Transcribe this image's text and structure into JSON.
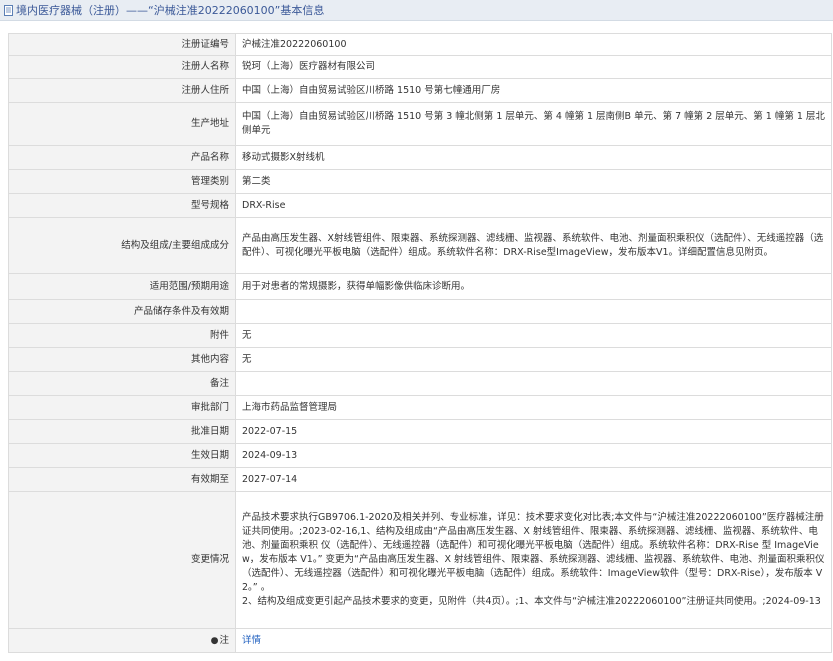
{
  "header": {
    "title": "境内医疗器械（注册）——“沪械注准20222060100”基本信息"
  },
  "rows": [
    {
      "label": "注册证编号",
      "value": "沪械注准20222060100"
    },
    {
      "label": "注册人名称",
      "value": "锐珂（上海）医疗器材有限公司"
    },
    {
      "label": "注册人住所",
      "value": "中国（上海）自由贸易试验区川桥路 1510 号第七幢通用厂房"
    },
    {
      "label": "生产地址",
      "value": "中国（上海）自由贸易试验区川桥路 1510 号第 3 幢北侧第 1 层单元、第 4 幢第 1 层南侧B 单元、第 7 幢第 2 层单元、第 1 幢第 1 层北侧单元"
    },
    {
      "label": "产品名称",
      "value": "移动式摄影X射线机"
    },
    {
      "label": "管理类别",
      "value": "第二类"
    },
    {
      "label": "型号规格",
      "value": "DRX-Rise"
    },
    {
      "label": "结构及组成/主要组成成分",
      "value": "产品由高压发生器、X射线管组件、限束器、系统探测器、滤线栅、监视器、系统软件、电池、剂量面积乘积仪（选配件）、无线遥控器（选配件）、可视化曝光平板电脑（选配件）组成。系统软件名称：DRX-Rise型ImageView，发布版本V1。详细配置信息见附页。"
    },
    {
      "label": "适用范围/预期用途",
      "value": "用于对患者的常规摄影，获得单幅影像供临床诊断用。"
    },
    {
      "label": "产品储存条件及有效期",
      "value": ""
    },
    {
      "label": "附件",
      "value": "无"
    },
    {
      "label": "其他内容",
      "value": "无"
    },
    {
      "label": "备注",
      "value": ""
    },
    {
      "label": "审批部门",
      "value": "上海市药品监督管理局"
    },
    {
      "label": "批准日期",
      "value": "2022-07-15"
    },
    {
      "label": "生效日期",
      "value": "2024-09-13"
    },
    {
      "label": "有效期至",
      "value": "2027-07-14"
    },
    {
      "label": "变更情况",
      "value": "产品技术要求执行GB9706.1-2020及相关并列、专业标准，详见：技术要求变化对比表;本文件与“沪械注准20222060100”医疗器械注册证共同使用。;2023-02-16,1、结构及组成由“产品由高压发生器、X 射线管组件、限束器、系统探测器、滤线栅、监视器、系统软件、电池、剂量面积乘积 仪（选配件）、无线遥控器（选配件）和可视化曝光平板电脑（选配件）组成。系统软件名称：DRX-Rise 型 ImageView，发布版本 V1。” 变更为“产品由高压发生器、X 射线管组件、限束器、系统探测器、滤线栅、监视器、系统软件、电池、剂量面积乘积仪（选配件）、无线遥控器（选配件）和可视化曝光平板电脑（选配件）组成。系统软件：ImageView软件（型号：DRX-Rise），发布版本 V2。” 。\n2、结构及组成变更引起产品技术要求的变更，见附件（共4页）。;1、本文件与“沪械注准20222060100”注册证共同使用。;2024-09-13"
    }
  ],
  "note_row": {
    "label": "注",
    "link_text": "详情"
  }
}
